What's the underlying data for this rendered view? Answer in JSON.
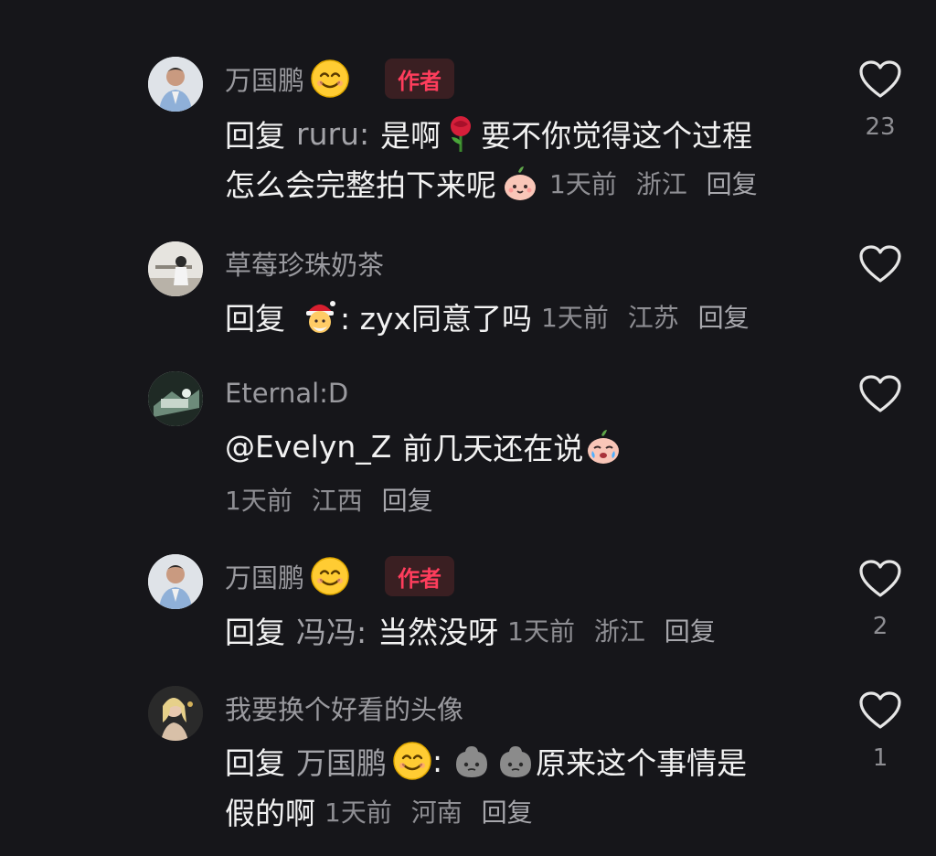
{
  "comments": [
    {
      "user": "万国鹏",
      "user_emoji": "smiling-face",
      "badge": "作者",
      "lines": [
        "回复",
        "ruru:",
        "是啊",
        "要不你觉得这个过程",
        "怎么会完整拍下来呢"
      ],
      "time": "1天前",
      "location": "浙江",
      "reply": "回复",
      "likes": "23"
    },
    {
      "user": "草莓珍珠奶茶",
      "lines": [
        "回复",
        ": zyx同意了吗"
      ],
      "time": "1天前",
      "location": "江苏",
      "reply": "回复",
      "likes": ""
    },
    {
      "user": "Eternal:D",
      "lines": [
        "@Evelyn_Z",
        "前几天还在说"
      ],
      "time": "1天前",
      "location": "江西",
      "reply": "回复",
      "likes": ""
    },
    {
      "user": "万国鹏",
      "user_emoji": "smiling-face",
      "badge": "作者",
      "lines": [
        "回复",
        "冯冯:",
        "当然没呀"
      ],
      "time": "1天前",
      "location": "浙江",
      "reply": "回复",
      "likes": "2"
    },
    {
      "user": "我要换个好看的头像",
      "lines": [
        "回复",
        "万国鹏",
        ":",
        "原来这个事情是",
        "假的啊"
      ],
      "time": "1天前",
      "location": "河南",
      "reply": "回复",
      "likes": "1"
    }
  ],
  "colors": {
    "background": "#16161a",
    "author_badge_text": "#fe3d5c",
    "author_badge_bg": "#3a1f22",
    "secondary_text": "#8e8e93"
  }
}
